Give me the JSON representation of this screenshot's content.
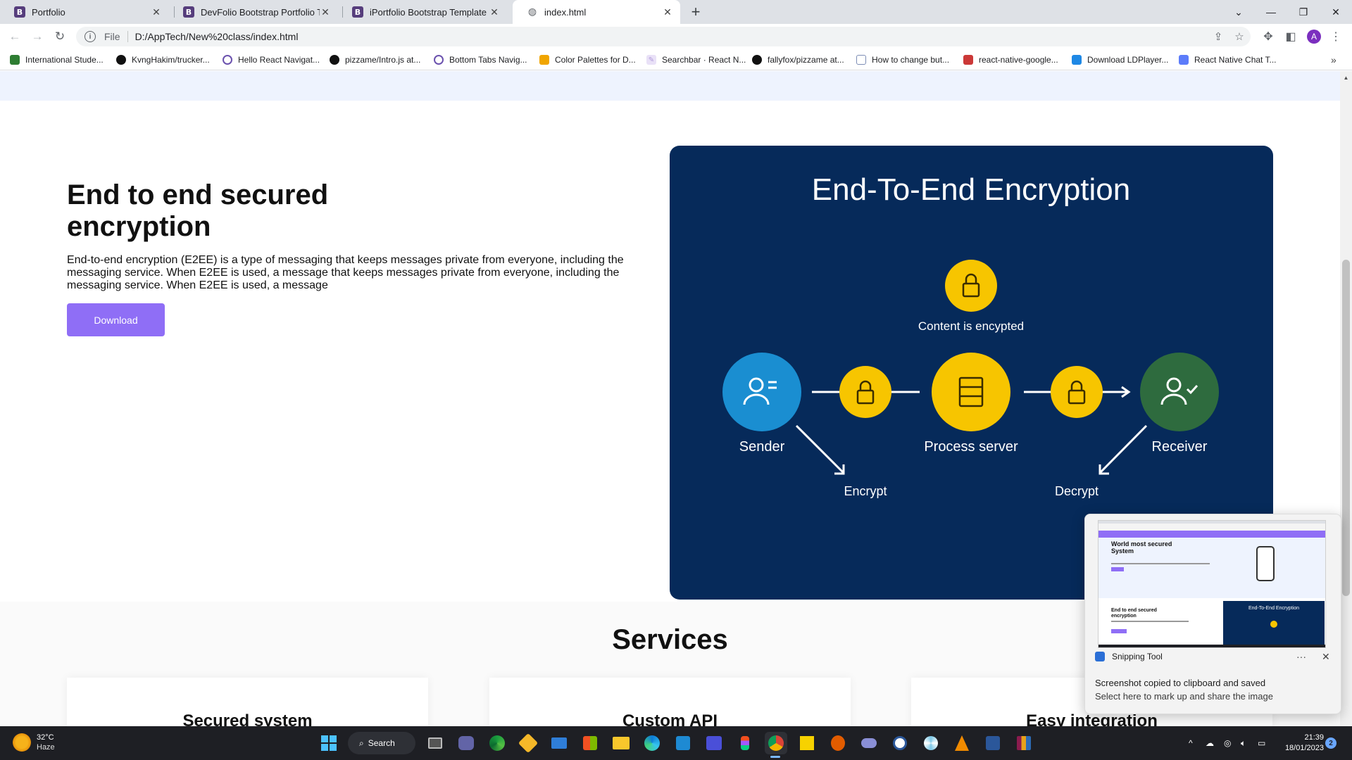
{
  "browser": {
    "tabs": [
      {
        "title": "Portfolio",
        "favicon": "B",
        "active": false
      },
      {
        "title": "DevFolio Bootstrap Portfolio Tem",
        "favicon": "B",
        "active": false
      },
      {
        "title": "iPortfolio Bootstrap Template - Ir",
        "favicon": "B",
        "active": false
      },
      {
        "title": "index.html",
        "favicon": "globe-icon",
        "active": true
      }
    ],
    "address": {
      "scheme_label": "File",
      "url": "D:/AppTech/New%20class/index.html"
    },
    "profile_initial": "A",
    "bookmarks": [
      {
        "label": "International Stude...",
        "icon": "shield-icon",
        "color": "#2e7d32"
      },
      {
        "label": "KvngHakim/trucker...",
        "icon": "github-icon",
        "color": "#111111"
      },
      {
        "label": "Hello React Navigat...",
        "icon": "react-navigation-icon",
        "color": "#6b52ae"
      },
      {
        "label": "pizzame/Intro.js at...",
        "icon": "github-icon",
        "color": "#111111"
      },
      {
        "label": "Bottom Tabs Navig...",
        "icon": "react-navigation-icon",
        "color": "#6b52ae"
      },
      {
        "label": "Color Palettes for D...",
        "icon": "palette-icon",
        "color": "#f0a500"
      },
      {
        "label": "Searchbar · React N...",
        "icon": "paper-icon",
        "color": "#b39ddb"
      },
      {
        "label": "fallyfox/pizzame at...",
        "icon": "github-icon",
        "color": "#111111"
      },
      {
        "label": "How to change but...",
        "icon": "page-icon",
        "color": "#7c8db5"
      },
      {
        "label": "react-native-google...",
        "icon": "npm-icon",
        "color": "#cb3837"
      },
      {
        "label": "Download LDPlayer...",
        "icon": "ldplayer-icon",
        "color": "#1e88e5"
      },
      {
        "label": "React Native Chat T...",
        "icon": "chat-icon",
        "color": "#5c7cfa"
      }
    ]
  },
  "page": {
    "hero": {
      "title": "End to end secured encryption",
      "description": "End-to-end encryption (E2EE) is a type of messaging that keeps messages private from everyone, including the messaging service. When E2EE is used, a message that keeps messages private from everyone, including the messaging service. When E2EE is used, a message",
      "button_label": "Download"
    },
    "illustration": {
      "title": "End-To-End Encryption",
      "content_label": "Content is encypted",
      "sender_label": "Sender",
      "server_label": "Process server",
      "receiver_label": "Receiver",
      "encrypt_label": "Encrypt",
      "decrypt_label": "Decrypt"
    },
    "services": {
      "title": "Services",
      "cards": [
        "Secured system",
        "Custom API",
        "Easy integration"
      ]
    }
  },
  "snipping_toast": {
    "app_name": "Snipping Tool",
    "message": "Screenshot copied to clipboard and saved",
    "hint": "Select here to mark up and share the image",
    "thumb_title": "World most secured System",
    "thumb_card_title": "End-To-End Encryption",
    "thumb_hero_title": "End to end secured encryption"
  },
  "taskbar": {
    "weather_temp": "32°C",
    "weather_desc": "Haze",
    "search_label": "Search",
    "time": "21:39",
    "date": "18/01/2023",
    "notification_count": "2"
  },
  "colors": {
    "accent_button": "#8f6ef6",
    "card_background": "#062a5a",
    "lock_yellow": "#f7c500",
    "sender_blue": "#1a8ed1",
    "receiver_green": "#2e6b3e"
  }
}
